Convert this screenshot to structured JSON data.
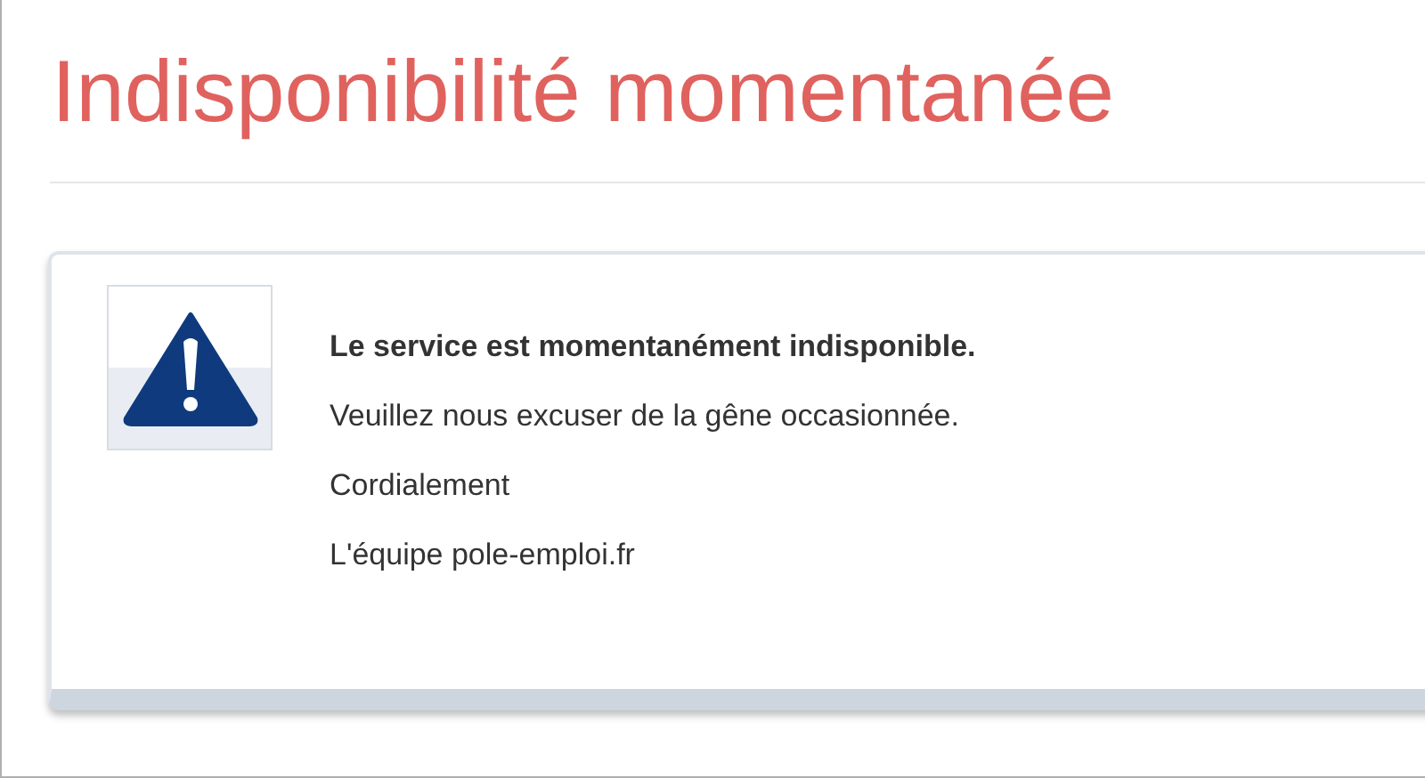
{
  "heading": "Indisponibilité momentanée",
  "message": {
    "title": "Le service est momentanément indisponible.",
    "lines": [
      "Veuillez nous excuser de la gêne occasionnée.",
      "Cordialement",
      "L'équipe pole-emploi.fr"
    ]
  }
}
